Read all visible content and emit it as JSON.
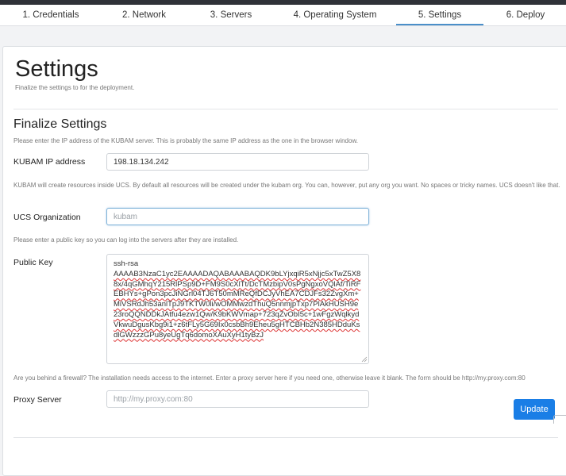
{
  "steps": [
    {
      "label": "1. Credentials",
      "active": false
    },
    {
      "label": "2. Network",
      "active": false
    },
    {
      "label": "3. Servers",
      "active": false
    },
    {
      "label": "4. Operating System",
      "active": false
    },
    {
      "label": "5. Settings",
      "active": true
    },
    {
      "label": "6. Deploy",
      "active": false
    }
  ],
  "page": {
    "title": "Settings",
    "subtitle": "Finalize the settings to for the deployment."
  },
  "section": {
    "title": "Finalize Settings",
    "ip_help": "Please enter the IP address of the KUBAM server. This is probably the same IP address as the one in the browser window.",
    "ip_label": "KUBAM IP address",
    "ip_value": "198.18.134.242",
    "org_help": "KUBAM will create resources inside UCS. By default all resources will be created under the kubam org. You can, however, put any org you want. No spaces or tricky names. UCS doesn't like that.",
    "org_label": "UCS Organization",
    "org_placeholder": "kubam",
    "key_help": "Please enter a public key so you can log into the servers after they are installed.",
    "key_label": "Public Key",
    "key_prefix": "ssh-rsa",
    "key_body": "AAAAB3NzaC1yc2EAAAADAQABAAABAQDK9bLYjxqiR5xNjjc5xTwZ5X88x/4qGMhqY215RlPSp9D+FM9S0cXlTt/DcTMzbipV0sPgNgxoVQlAf/TiRFEBHYs+gPon3pcJiNGrl04TJ6T50mMReQfDCJyVhEA7CDJFs32ZvgXm+MiVSRdJh53anlTpJ9TKTW0li/wOMMwzdThuQ5nnmjpTxp7PlAkHUSH9e23roQQNDDkJAtfu4ezw1Qw/K9bKWVmap+723qZvObI5c+1wFgzWqlkydVkwuDgusKbg9i1+z6tFLy5G69Ix0csbBh9Eheu5gHTCBHb2N385HDduKsdlGWzzzGPu8yeUgTq6domoXAuXyH1tyBzJ",
    "proxy_help": "Are you behind a firewall? The installation needs access to the internet. Enter a proxy server here if you need one, otherwise leave it blank. The form should be http://my.proxy.com:80",
    "proxy_label": "Proxy Server",
    "proxy_placeholder": "http://my.proxy.com:80"
  },
  "actions": {
    "update_label": "Update"
  },
  "colors": {
    "accent": "#1a7ee6",
    "active_tab_underline": "#4b8fc9"
  }
}
